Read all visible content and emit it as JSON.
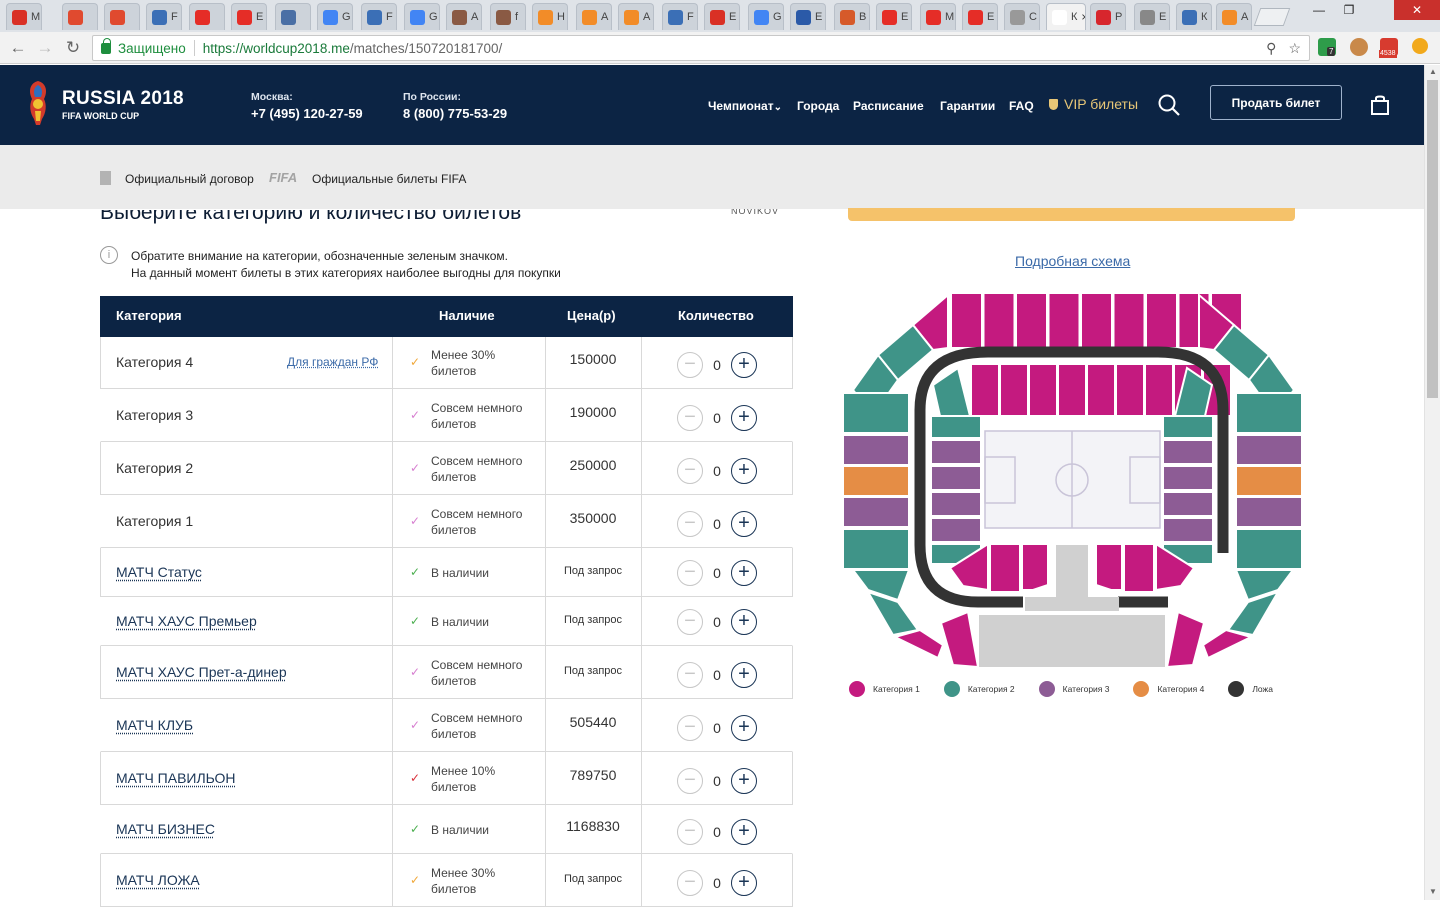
{
  "browser": {
    "tabs": [
      {
        "label": "М",
        "color": "#d93025"
      },
      {
        "label": "",
        "color": "#e04a2f"
      },
      {
        "label": "",
        "color": "#e04a2f"
      },
      {
        "label": "F",
        "color": "#3b6fb6"
      },
      {
        "label": "",
        "color": "#e52d27"
      },
      {
        "label": "Е",
        "color": "#e52d27"
      },
      {
        "label": "",
        "color": "#4a6fa5"
      },
      {
        "label": "G",
        "color": "#4285f4"
      },
      {
        "label": "F",
        "color": "#3b6fb6"
      },
      {
        "label": "G у",
        "color": "#4285f4"
      },
      {
        "label": "А",
        "color": "#8a5a44"
      },
      {
        "label": "f",
        "color": "#8a5a44"
      },
      {
        "label": "Н",
        "color": "#f28c28"
      },
      {
        "label": "А",
        "color": "#f28c28"
      },
      {
        "label": "А",
        "color": "#f28c28"
      },
      {
        "label": "F",
        "color": "#3b6fb6"
      },
      {
        "label": "Е",
        "color": "#d93025"
      },
      {
        "label": "G к",
        "color": "#4285f4"
      },
      {
        "label": "Е",
        "color": "#2b5aa8"
      },
      {
        "label": "В",
        "color": "#d65a2a"
      },
      {
        "label": "Е",
        "color": "#e52d27"
      },
      {
        "label": "М",
        "color": "#e52d27"
      },
      {
        "label": "Е",
        "color": "#e52d27"
      },
      {
        "label": "С",
        "color": "#999999"
      },
      {
        "label": "К",
        "color": "#ffffff"
      },
      {
        "label": "Р",
        "color": "#d7262d"
      },
      {
        "label": "Е",
        "color": "#888888"
      },
      {
        "label": "К",
        "color": "#3b6fb6"
      },
      {
        "label": "А",
        "color": "#f28c28"
      }
    ],
    "active_tab_close": "×",
    "window_controls": {
      "minimize": "—",
      "restore": "❐",
      "close": "✕"
    },
    "secure_label": "Защищено",
    "url_host": "https://worldcup2018.me",
    "url_path": "/matches/150720181700/",
    "ext_badge_count": "7",
    "mail_badge_count": "4538",
    "nav_icons": {
      "back": "←",
      "forward": "→",
      "reload": "↻",
      "zoom": "⚲",
      "star": "☆",
      "menu": "⋮"
    }
  },
  "header": {
    "brand_title": "RUSSIA 2018",
    "brand_sub": "FIFA WORLD CUP",
    "phones": [
      {
        "label": "Москва:",
        "number": "+7 (495) 120-27-59"
      },
      {
        "label": "По России:",
        "number": "8 (800) 775-53-29"
      }
    ],
    "nav": [
      "Чемпионат",
      "Города",
      "Расписание",
      "Гарантии",
      "FAQ"
    ],
    "nav_dropdown_marker": "⌄",
    "vip_label": "VIP билеты",
    "sell_button": "Продать билет"
  },
  "subbar": {
    "contract": "Официальный договор",
    "fifa_logo": "FIFA",
    "fifa_tickets": "Официальные билеты FIFA"
  },
  "content": {
    "title": "Выберите категорию и количество билетов",
    "hotel_logo_text": "NOVIKOV",
    "info_icon_glyph": "i",
    "notice_line1": "Обратите внимание на категории, обозначенные зеленым значком.",
    "notice_line2": "На данный момент билеты в этих категориях наиболее выгодны для покупки",
    "table_headers": [
      "Категория",
      "Наличие",
      "Цена(р)",
      "Количество"
    ],
    "rf_citizens_link": "Для граждан РФ",
    "qty_minus": "−",
    "qty_plus": "+",
    "check_glyph": "✓",
    "rows": [
      {
        "name": "Категория 4",
        "link": false,
        "avail": "Менее 30% билетов",
        "check_color": "#f0a83a",
        "price": "150000",
        "qty": "0"
      },
      {
        "name": "Категория 3",
        "link": false,
        "avail": "Совсем немного билетов",
        "check_color": "#d77fd0",
        "price": "190000",
        "qty": "0"
      },
      {
        "name": "Категория 2",
        "link": false,
        "avail": "Совсем немного билетов",
        "check_color": "#d77fd0",
        "price": "250000",
        "qty": "0"
      },
      {
        "name": "Категория 1",
        "link": false,
        "avail": "Совсем немного билетов",
        "check_color": "#d77fd0",
        "price": "350000",
        "qty": "0"
      },
      {
        "name": "МАТЧ Статус",
        "link": true,
        "avail": "В наличии",
        "check_color": "#4caf50",
        "price": "Под запрос",
        "qty": "0"
      },
      {
        "name": "МАТЧ ХАУС Премьер",
        "link": true,
        "avail": "В наличии",
        "check_color": "#4caf50",
        "price": "Под запрос",
        "qty": "0"
      },
      {
        "name": "МАТЧ ХАУС Прет-а-динер",
        "link": true,
        "avail": "Совсем немного билетов",
        "check_color": "#d77fd0",
        "price": "Под запрос",
        "qty": "0"
      },
      {
        "name": "МАТЧ КЛУБ",
        "link": true,
        "avail": "Совсем немного билетов",
        "check_color": "#d77fd0",
        "price": "505440",
        "qty": "0"
      },
      {
        "name": "МАТЧ ПАВИЛЬОН",
        "link": true,
        "avail": "Менее 10% билетов",
        "check_color": "#d9303a",
        "price": "789750",
        "qty": "0"
      },
      {
        "name": "МАТЧ БИЗНЕС",
        "link": true,
        "avail": "В наличии",
        "check_color": "#4caf50",
        "price": "1168830",
        "qty": "0"
      },
      {
        "name": "МАТЧ ЛОЖА",
        "link": true,
        "avail": "Менее 30% билетов",
        "check_color": "#f0a83a",
        "price": "Под запрос",
        "qty": "0"
      }
    ],
    "scheme_link": "Подробная схема",
    "legend": [
      {
        "label": "Категория 1",
        "color": "#c41a7f"
      },
      {
        "label": "Категория 2",
        "color": "#3f9488"
      },
      {
        "label": "Категория 3",
        "color": "#8d5c95"
      },
      {
        "label": "Категория 4",
        "color": "#e58d45"
      },
      {
        "label": "Ложа",
        "color": "#333333"
      }
    ],
    "scroll_up": "▲",
    "scroll_down": "▼"
  }
}
